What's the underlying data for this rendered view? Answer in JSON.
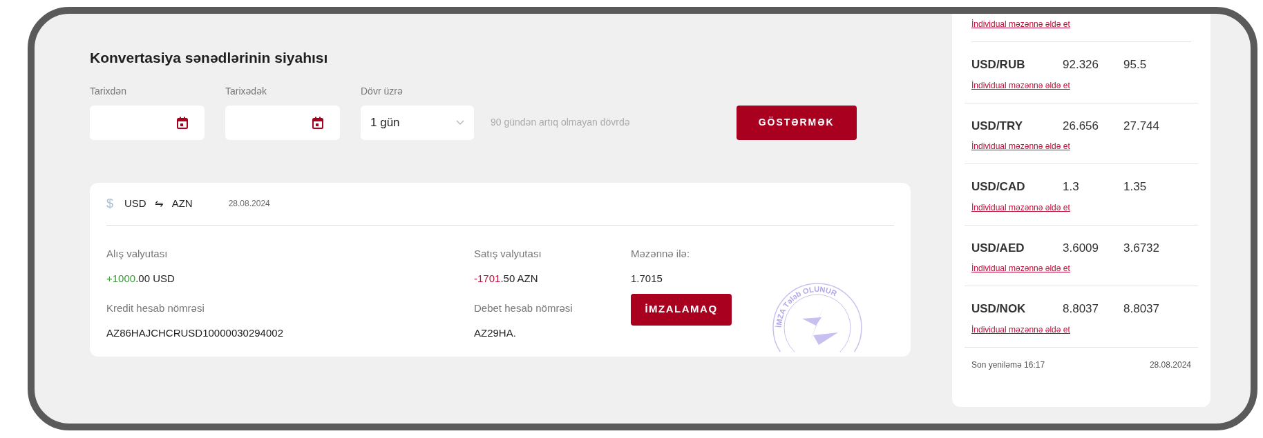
{
  "title": "Konvertasiya sənədlərinin siyahısı",
  "filters": {
    "from": {
      "label": "Tarixdən"
    },
    "to": {
      "label": "Tarixədək"
    },
    "period": {
      "label": "Dövr üzrə",
      "value": "1 gün"
    },
    "hint": "90 gündən artıq olmayan dövrdə",
    "button": "GÖSTƏRMƏK"
  },
  "document": {
    "currency_symbol": "$",
    "from": "USD",
    "swap": "⇋",
    "to": "AZN",
    "date": "28.08.2024",
    "fields": [
      {
        "label": "Alış valyutası",
        "kind": "credit",
        "highlight": "+1000",
        "rest": ".00 USD"
      },
      {
        "label": "Satış valyutası",
        "kind": "debit",
        "highlight": "-1701",
        "rest": ".50 AZN"
      },
      {
        "label": "Məzənnə ilə:",
        "rest": "1.7015"
      },
      {
        "label": "Kredit hesab nömrəsi",
        "rest": "AZ86HAJCHCRUSD10000030294002"
      },
      {
        "label": "Debet hesab nömrəsi",
        "rest": "AZ29HA."
      }
    ],
    "sign_button": "İMZALAMAQ",
    "stamp_text": "İMZA Tələb OLUNUR"
  },
  "rates": {
    "top_link": "İndividual məzənnə əldə et",
    "items": [
      {
        "pair": "USD/RUB",
        "buy": "92.326",
        "sell": "95.5",
        "link": "İndividual məzənnə əldə et"
      },
      {
        "pair": "USD/TRY",
        "buy": "26.656",
        "sell": "27.744",
        "link": "İndividual məzənnə əldə et"
      },
      {
        "pair": "USD/CAD",
        "buy": "1.3",
        "sell": "1.35",
        "link": "İndividual məzənnə əldə et"
      },
      {
        "pair": "USD/AED",
        "buy": "3.6009",
        "sell": "3.6732",
        "link": "İndividual məzənnə əldə et"
      },
      {
        "pair": "USD/NOK",
        "buy": "8.8037",
        "sell": "8.8037",
        "link": "İndividual məzənnə əldə et"
      }
    ],
    "updated": "Son yeniləmə 16:17",
    "date": "28.08.2024"
  }
}
